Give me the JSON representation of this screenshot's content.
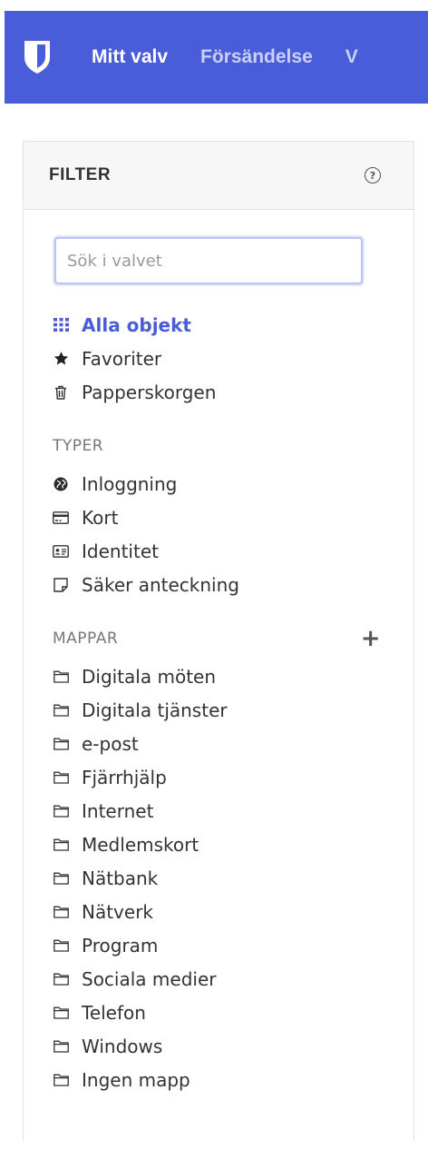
{
  "navbar": {
    "items": [
      {
        "label": "Mitt valv",
        "active": true
      },
      {
        "label": "Försändelse",
        "active": false
      },
      {
        "label": "V",
        "active": false
      }
    ],
    "brand_color": "#4a5dd8"
  },
  "filter": {
    "title": "FILTER",
    "help_icon": "question-circle-icon",
    "search_placeholder": "Sök i valvet",
    "collections": [
      {
        "label": "Alla objekt",
        "icon": "grid-icon",
        "active": true
      },
      {
        "label": "Favoriter",
        "icon": "star-icon",
        "active": false
      },
      {
        "label": "Papperskorgen",
        "icon": "trash-icon",
        "active": false
      }
    ],
    "types_title": "TYPER",
    "types": [
      {
        "label": "Inloggning",
        "icon": "globe-icon"
      },
      {
        "label": "Kort",
        "icon": "credit-card-icon"
      },
      {
        "label": "Identitet",
        "icon": "id-card-icon"
      },
      {
        "label": "Säker anteckning",
        "icon": "note-icon"
      }
    ],
    "folders_title": "MAPPAR",
    "add_folder_icon": "plus-icon",
    "folders": [
      "Digitala möten",
      "Digitala tjänster",
      "e-post",
      "Fjärrhjälp",
      "Internet",
      "Medlemskort",
      "Nätbank",
      "Nätverk",
      "Program",
      "Sociala medier",
      "Telefon",
      "Windows",
      "Ingen mapp"
    ]
  }
}
